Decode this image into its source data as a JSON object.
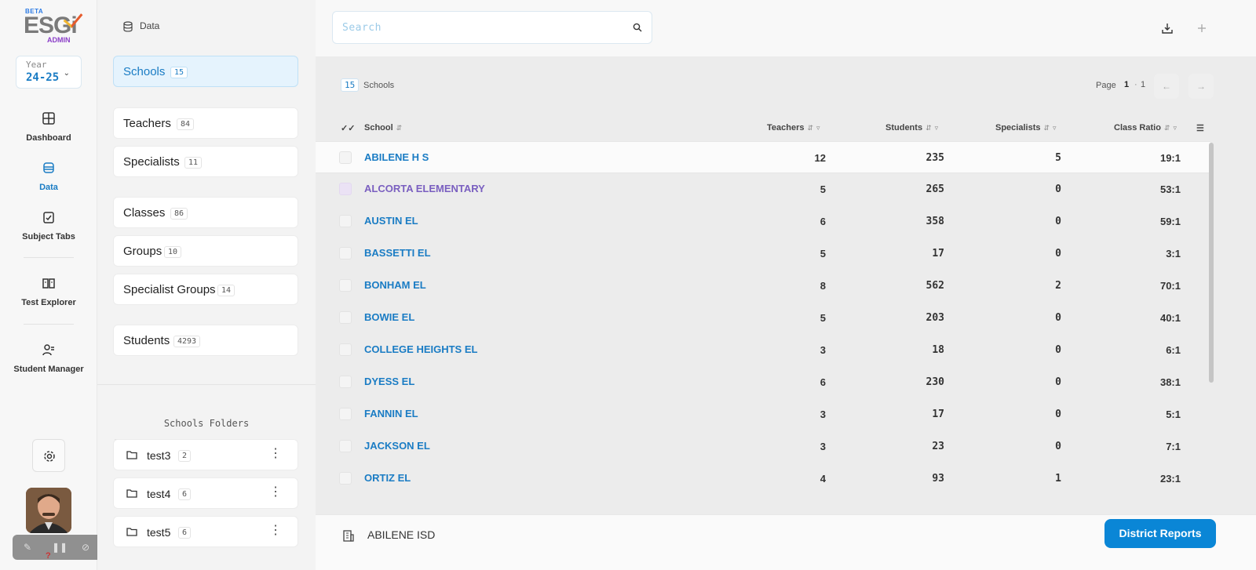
{
  "logo": {
    "beta": "BETA",
    "word": "ESGi",
    "sub": "ADMIN"
  },
  "year": {
    "label": "Year",
    "value": "24-25"
  },
  "nav": [
    {
      "label": "Dashboard",
      "icon": "dashboard-icon"
    },
    {
      "label": "Data",
      "icon": "data-icon",
      "active": true
    },
    {
      "label": "Subject Tabs",
      "icon": "subject-tabs-icon"
    },
    {
      "label": "Test Explorer",
      "icon": "test-explorer-icon"
    },
    {
      "label": "Student Manager",
      "icon": "student-manager-icon"
    }
  ],
  "panel": {
    "header": "Data",
    "entities": [
      {
        "name": "Schools",
        "count": "15",
        "active": true
      },
      {
        "name": "Teachers",
        "count": "84"
      },
      {
        "name": "Specialists",
        "count": "11"
      },
      {
        "name": "Classes",
        "count": "86"
      },
      {
        "name": "Groups",
        "count": "10"
      },
      {
        "name": "Specialist Groups",
        "count": "14"
      },
      {
        "name": "Students",
        "count": "4293"
      }
    ],
    "folders_title": "Schools Folders",
    "folders": [
      {
        "name": "test3",
        "count": "2"
      },
      {
        "name": "test4",
        "count": "6"
      },
      {
        "name": "test5",
        "count": "6"
      }
    ]
  },
  "search": {
    "placeholder": "Search"
  },
  "list": {
    "count": "15",
    "count_label": "Schools",
    "pager_label": "Page",
    "pager_current": "1",
    "pager_sep": "·",
    "pager_total": "1"
  },
  "table": {
    "columns": [
      "School",
      "Teachers",
      "Students",
      "Specialists",
      "Class Ratio"
    ],
    "rows": [
      {
        "school": "ABILENE H S",
        "teachers": "12",
        "students": "235",
        "specialists": "5",
        "ratio": "19:1"
      },
      {
        "school": "ALCORTA ELEMENTARY",
        "teachers": "5",
        "students": "265",
        "specialists": "0",
        "ratio": "53:1"
      },
      {
        "school": "AUSTIN EL",
        "teachers": "6",
        "students": "358",
        "specialists": "0",
        "ratio": "59:1"
      },
      {
        "school": "BASSETTI EL",
        "teachers": "5",
        "students": "17",
        "specialists": "0",
        "ratio": "3:1"
      },
      {
        "school": "BONHAM EL",
        "teachers": "8",
        "students": "562",
        "specialists": "2",
        "ratio": "70:1"
      },
      {
        "school": "BOWIE EL",
        "teachers": "5",
        "students": "203",
        "specialists": "0",
        "ratio": "40:1"
      },
      {
        "school": "COLLEGE HEIGHTS EL",
        "teachers": "3",
        "students": "18",
        "specialists": "0",
        "ratio": "6:1"
      },
      {
        "school": "DYESS EL",
        "teachers": "6",
        "students": "230",
        "specialists": "0",
        "ratio": "38:1"
      },
      {
        "school": "FANNIN EL",
        "teachers": "3",
        "students": "17",
        "specialists": "0",
        "ratio": "5:1"
      },
      {
        "school": "JACKSON EL",
        "teachers": "3",
        "students": "23",
        "specialists": "0",
        "ratio": "7:1"
      },
      {
        "school": "ORTIZ EL",
        "teachers": "4",
        "students": "93",
        "specialists": "1",
        "ratio": "23:1"
      }
    ]
  },
  "footer": {
    "district": "ABILENE ISD",
    "reports_button": "District Reports"
  },
  "recorder": {
    "help": "?"
  },
  "colors": {
    "accent": "#1a7cc4",
    "button": "#0a86d6",
    "purple_row": "#7a5fc0"
  }
}
